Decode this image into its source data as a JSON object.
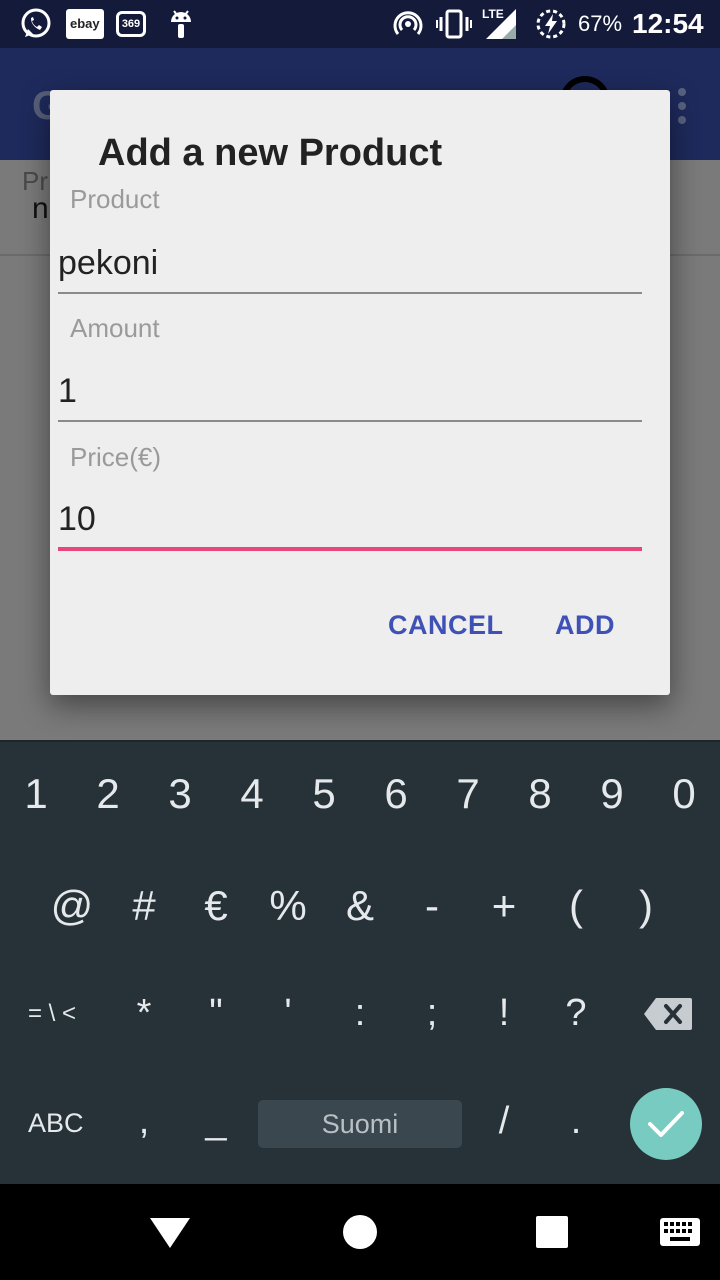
{
  "status_bar": {
    "notification_icons": [
      "whatsapp-icon",
      "ebay-icon",
      "369-icon",
      "android-icon"
    ],
    "ebay_label": "ebay",
    "badge_369": "369",
    "network_label": "LTE",
    "battery_percent": "67%",
    "time": "12:54"
  },
  "dialog": {
    "title": "Add a new Product",
    "fields": [
      {
        "label": "Product",
        "value": "pekoni"
      },
      {
        "label": "Amount",
        "value": "1"
      },
      {
        "label": "Price(€)",
        "value": "10"
      }
    ],
    "cancel_label": "CANCEL",
    "add_label": "ADD"
  },
  "keyboard": {
    "row1": [
      "1",
      "2",
      "3",
      "4",
      "5",
      "6",
      "7",
      "8",
      "9",
      "0"
    ],
    "row2": [
      "@",
      "#",
      "€",
      "%",
      "&",
      "-",
      "+",
      "(",
      ")"
    ],
    "row3": [
      "= \\ <",
      "*",
      "\"",
      "'",
      ":",
      ";",
      "!",
      "?"
    ],
    "abc_label": "ABC",
    "comma": ",",
    "underscore": "_",
    "language_label": "Suomi",
    "slash": "/",
    "period": ".",
    "enter_color": "#78cbc0"
  },
  "colors": {
    "accent_underline": "#e8457f",
    "button_text": "#3f51b5",
    "keyboard_bg": "#263238"
  }
}
